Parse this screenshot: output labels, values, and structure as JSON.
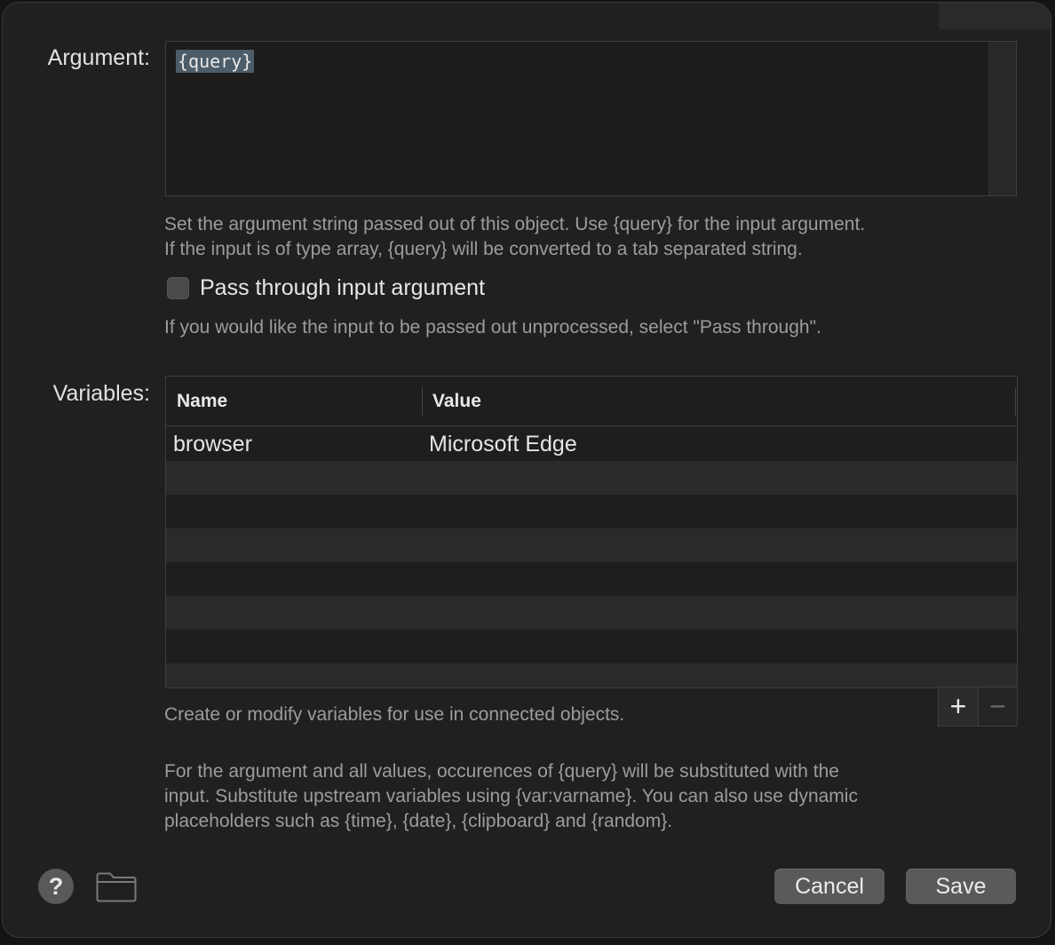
{
  "argument": {
    "label": "Argument:",
    "value": "{query}",
    "help_line1": "Set the argument string passed out of this object. Use {query} for the input argument.",
    "help_line2": "If the input is of type array, {query} will be converted to a tab separated string."
  },
  "passthrough": {
    "label": "Pass through input argument",
    "checked": false,
    "help": "If you would like the input to be passed out unprocessed, select \"Pass through\"."
  },
  "variables": {
    "label": "Variables:",
    "columns": [
      "Name",
      "Value"
    ],
    "rows": [
      {
        "name": "browser",
        "value": "Microsoft Edge"
      }
    ],
    "add_label": "+",
    "remove_label": "−",
    "help": "Create or modify variables for use in connected objects."
  },
  "footer_help": {
    "line1": "For the argument and all values, occurences of {query} will be substituted with the",
    "line2": "input. Substitute upstream variables using {var:varname}. You can also use dynamic",
    "line3": "placeholders such as {time}, {date}, {clipboard} and {random}."
  },
  "buttons": {
    "help": "?",
    "cancel": "Cancel",
    "save": "Save"
  },
  "icons": [
    "question-icon",
    "folder-icon",
    "plus-icon",
    "minus-icon"
  ],
  "colors": {
    "background": "#202020",
    "selection": "#4d5c69",
    "button": "#5a5a5a"
  }
}
